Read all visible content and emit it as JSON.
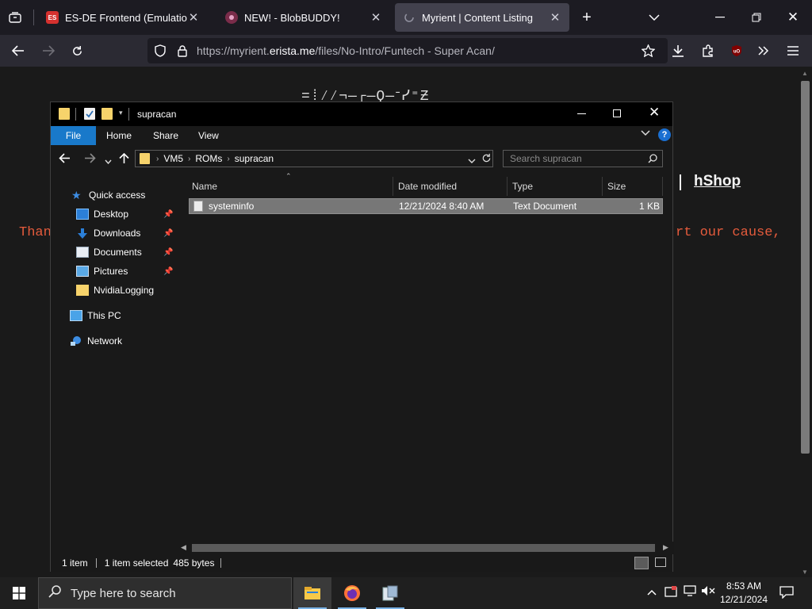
{
  "browser": {
    "tabs": [
      {
        "title": "ES-DE Frontend (EmulationStat",
        "favicon": "ES",
        "active": false
      },
      {
        "title": "NEW! - BlobBUDDY!",
        "active": false
      },
      {
        "title": "Myrient | Content Listing",
        "active": true
      }
    ],
    "url_prefix": "https://myrient.",
    "url_domain": "erista.me",
    "url_suffix": "/files/No-Intro/Funtech - Super Acan/"
  },
  "page": {
    "link_hshop": "hShop",
    "peek_left": "Than",
    "peek_right": "rt our cause,",
    "banner_ascii": "=⁞⁄⁄¬—┌—Ϙ—ᐨᓯ⁼Ƶ"
  },
  "explorer": {
    "title": "supracan",
    "ribbon": {
      "file": "File",
      "home": "Home",
      "share": "Share",
      "view": "View"
    },
    "breadcrumb": [
      "VM5",
      "ROMs",
      "supracan"
    ],
    "search_placeholder": "Search supracan",
    "nav": {
      "quick_access": "Quick access",
      "items": [
        "Desktop",
        "Downloads",
        "Documents",
        "Pictures",
        "NvidiaLogging"
      ],
      "this_pc": "This PC",
      "network": "Network"
    },
    "columns": [
      "Name",
      "Date modified",
      "Type",
      "Size"
    ],
    "file": {
      "name": "systeminfo",
      "date": "12/21/2024 8:40 AM",
      "type": "Text Document",
      "size": "1 KB"
    },
    "status": {
      "count": "1 item",
      "selected": "1 item selected",
      "size": "485 bytes"
    }
  },
  "taskbar": {
    "search_placeholder": "Type here to search",
    "time": "8:53 AM",
    "date": "12/21/2024"
  }
}
